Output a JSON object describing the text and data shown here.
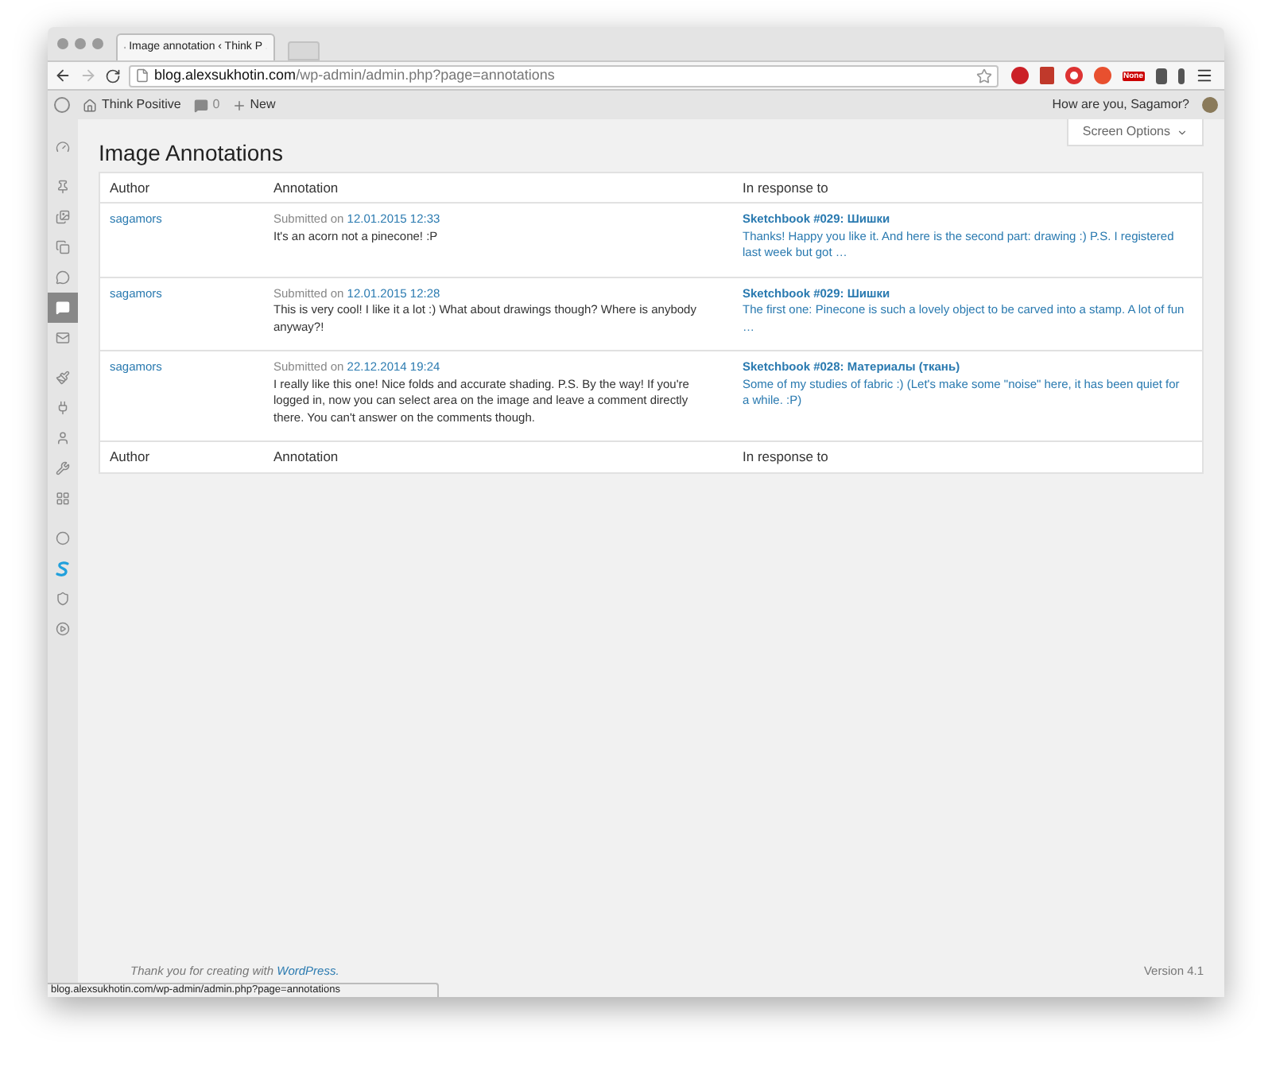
{
  "browser": {
    "tab_title": "Image annotation ‹ Think P",
    "url_host": "blog.alexsukhotin.com",
    "url_path": "/wp-admin/admin.php?page=annotations",
    "extension_badge": "None",
    "status_url": "blog.alexsukhotin.com/wp-admin/admin.php?page=annotations"
  },
  "admin_bar": {
    "site_name": "Think Positive",
    "comment_count": "0",
    "new_label": "New",
    "greeting": "How are you, Sagamor?"
  },
  "sidebar": {
    "items": [
      {
        "selected": false
      },
      {
        "selected": false
      },
      {
        "selected": false
      },
      {
        "selected": false
      },
      {
        "selected": false
      },
      {
        "selected": true
      },
      {
        "selected": false
      },
      {
        "selected": false
      },
      {
        "selected": false
      },
      {
        "selected": false
      },
      {
        "selected": false
      },
      {
        "selected": false
      },
      {
        "selected": false
      },
      {
        "selected": false
      },
      {
        "selected": false
      },
      {
        "selected": false
      }
    ]
  },
  "page": {
    "title": "Image Annotations",
    "screen_options": "Screen Options"
  },
  "table": {
    "columns": [
      "Author",
      "Annotation",
      "In response to"
    ],
    "rows": [
      {
        "author": "sagamors",
        "submitted_label": "Submitted on",
        "date": "12.01.2015 12:33",
        "text": "It's an acorn not a pinecone! :P",
        "response_title": "Sketchbook #029: Шишки",
        "response_text": "Thanks! Happy you like it. And here is the second part: drawing :) P.S. I registered last week but got …"
      },
      {
        "author": "sagamors",
        "submitted_label": "Submitted on",
        "date": "12.01.2015 12:28",
        "text": "This is very cool! I like it a lot :) What about drawings though? Where is anybody anyway?!",
        "response_title": "Sketchbook #029: Шишки",
        "response_text": "The first one: Pinecone is such a lovely object to be carved into a stamp. A lot of fun …"
      },
      {
        "author": "sagamors",
        "submitted_label": "Submitted on",
        "date": "22.12.2014 19:24",
        "text": "I really like this one! Nice folds and accurate shading. P.S. By the way! If you're logged in, now you can select area on the image and leave a comment directly there. You can't answer on the comments though.",
        "response_title": "Sketchbook #028: Материалы (ткань)",
        "response_text": "Some of my studies of fabric :) (Let's make some \"noise\" here, it has been quiet for a while. :P)"
      }
    ],
    "footer_columns": [
      "Author",
      "Annotation",
      "In response to"
    ]
  },
  "footer": {
    "thanks": "Thank you for creating with ",
    "link": "WordPress.",
    "version": "Version 4.1"
  }
}
